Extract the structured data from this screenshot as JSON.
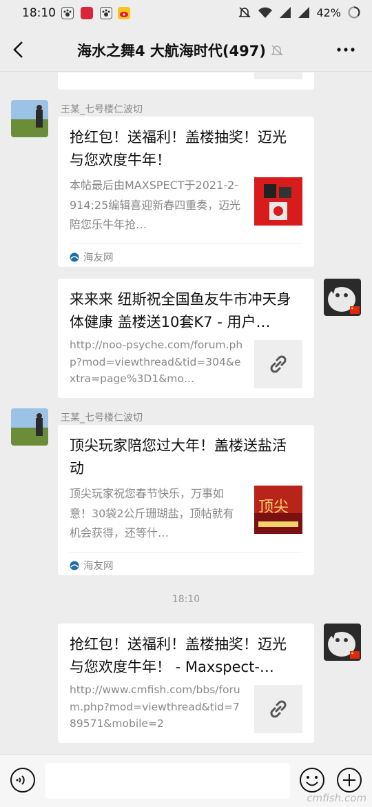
{
  "status_bar": {
    "time": "18:10",
    "battery": "42%",
    "app_icons": [
      "paw-app-icon",
      "notification-app-icon",
      "paw-app-icon",
      "weibo-app-icon"
    ]
  },
  "header": {
    "title": "海水之舞4 大航海时代(497)",
    "muted_icon": "bell-muted-icon"
  },
  "messages": [
    {
      "sender": "王某_七号楼仁波切",
      "title": "抢红包！送福利！盖楼抽奖！迈光与您欢度牛年！",
      "desc": "本帖最后由MAXSPECT于2021-2-914:25编辑喜迎新春四重奏，迈光陪您乐牛年抢…",
      "source": "海友网"
    },
    {
      "title": "来来来 纽斯祝全国鱼友牛市冲天身体健康 盖楼送10套K7 - 用户…",
      "url": "http://noo-psyche.com/forum.php?mod=viewthread&tid=304&extra=page%3D1&mo…"
    },
    {
      "sender": "王某_七号楼仁波切",
      "title": "顶尖玩家陪您过大年！盖楼送盐活动",
      "desc": "顶尖玩家祝您春节快乐，万事如意！30袋2公斤珊瑚盐，顶帖就有机会获得，还等什…",
      "source": "海友网"
    },
    {
      "title": "抢红包！送福利！盖楼抽奖！迈光与您欢度牛年！ - Maxspect-…",
      "url": "http://www.cmfish.com/bbs/forum.php?mod=viewthread&tid=789571&mobile=2"
    }
  ],
  "time_separator": "18:10",
  "watermark": "cmfish.com",
  "colors": {
    "background": "#ededed",
    "card": "#ffffff",
    "meta_text": "#888888"
  }
}
